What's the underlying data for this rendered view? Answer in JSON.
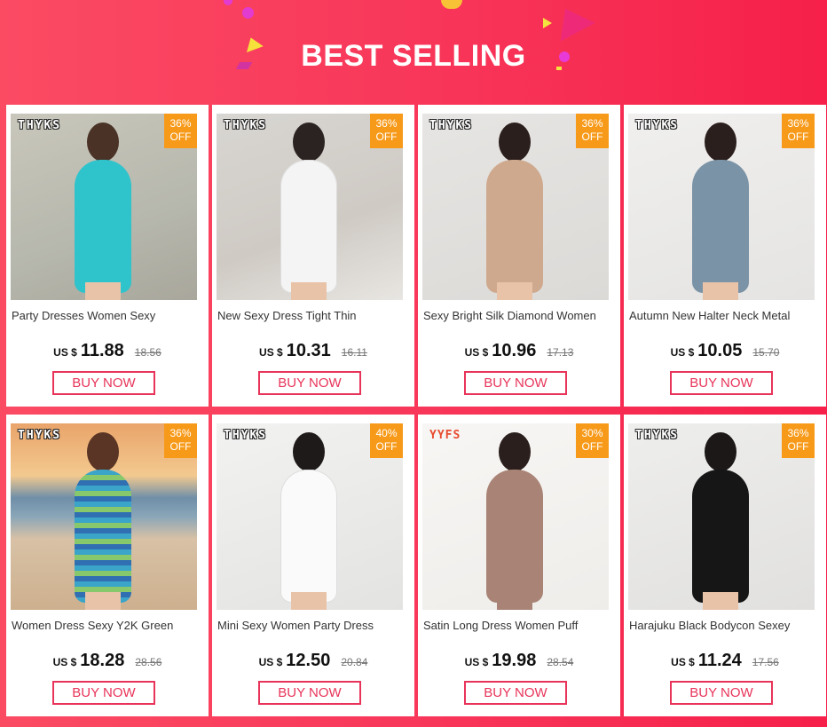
{
  "header": {
    "title": "BEST SELLING"
  },
  "colors": {
    "accent": "#e8345a",
    "badge": "#f79a1a",
    "background": "#f8375a"
  },
  "products": [
    {
      "brand": "THYKS",
      "discount": "36%",
      "discount_unit": "OFF",
      "name": "Party Dresses Women Sexy",
      "currency": "US $",
      "price": "11.88",
      "old_price": "18.56",
      "button": "BUY NOW"
    },
    {
      "brand": "THYKS",
      "discount": "36%",
      "discount_unit": "OFF",
      "name": "New Sexy Dress Tight Thin",
      "currency": "US $",
      "price": "10.31",
      "old_price": "16.11",
      "button": "BUY NOW"
    },
    {
      "brand": "THYKS",
      "discount": "36%",
      "discount_unit": "OFF",
      "name": "Sexy Bright Silk Diamond Women",
      "currency": "US $",
      "price": "10.96",
      "old_price": "17.13",
      "button": "BUY NOW"
    },
    {
      "brand": "THYKS",
      "discount": "36%",
      "discount_unit": "OFF",
      "name": "Autumn New Halter Neck Metal",
      "currency": "US $",
      "price": "10.05",
      "old_price": "15.70",
      "button": "BUY NOW"
    },
    {
      "brand": "THYKS",
      "discount": "36%",
      "discount_unit": "OFF",
      "name": "Women Dress Sexy Y2K Green",
      "currency": "US $",
      "price": "18.28",
      "old_price": "28.56",
      "button": "BUY NOW"
    },
    {
      "brand": "THYKS",
      "discount": "40%",
      "discount_unit": "OFF",
      "name": "Mini Sexy Women Party Dress",
      "currency": "US $",
      "price": "12.50",
      "old_price": "20.84",
      "button": "BUY NOW"
    },
    {
      "brand": "YYFS",
      "discount": "30%",
      "discount_unit": "OFF",
      "name": "Satin Long Dress Women Puff",
      "currency": "US $",
      "price": "19.98",
      "old_price": "28.54",
      "button": "BUY NOW"
    },
    {
      "brand": "THYKS",
      "discount": "36%",
      "discount_unit": "OFF",
      "name": "Harajuku Black Bodycon Sexey",
      "currency": "US $",
      "price": "11.24",
      "old_price": "17.56",
      "button": "BUY NOW"
    }
  ]
}
